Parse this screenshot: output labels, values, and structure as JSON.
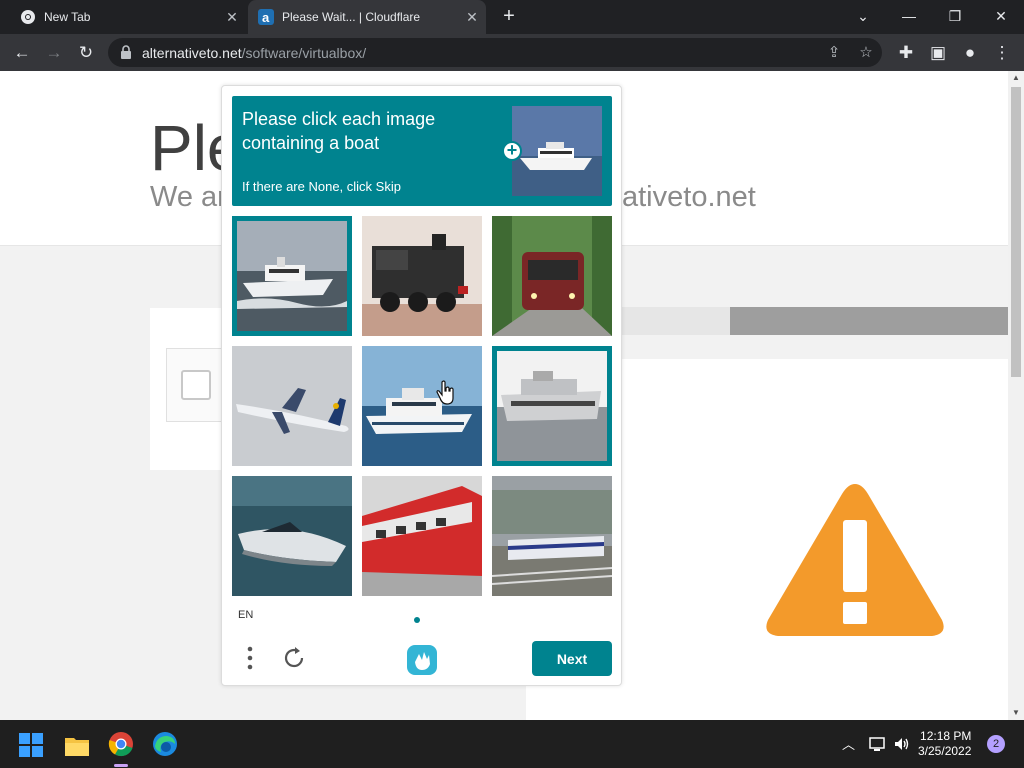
{
  "browser": {
    "tabs": [
      {
        "title": "New Tab"
      },
      {
        "title": "Please Wait... | Cloudflare"
      }
    ],
    "url_host": "alternativeto.net",
    "url_path": "/software/virtualbox/"
  },
  "page_bg": {
    "title_fragment": "Ple",
    "subtitle_fragment_left": "We ar",
    "subtitle_fragment_right": "ativeto.net",
    "warning_color": "#f39a2b"
  },
  "captcha": {
    "prompt": "Please click each image containing a boat",
    "prompt_sub": "If there are None, click Skip",
    "accent_color": "#00838f",
    "tiles": [
      {
        "subject": "boat",
        "selected": true
      },
      {
        "subject": "steam-locomotive",
        "selected": false
      },
      {
        "subject": "train",
        "selected": false
      },
      {
        "subject": "airplane",
        "selected": false
      },
      {
        "subject": "yacht",
        "selected": false
      },
      {
        "subject": "yacht",
        "selected": true
      },
      {
        "subject": "speedboat",
        "selected": false
      },
      {
        "subject": "red-train",
        "selected": false
      },
      {
        "subject": "passenger-train",
        "selected": false
      }
    ],
    "language": "EN",
    "next_label": "Next"
  },
  "taskbar": {
    "time": "12:18 PM",
    "date": "3/25/2022",
    "notification_count": "2"
  }
}
